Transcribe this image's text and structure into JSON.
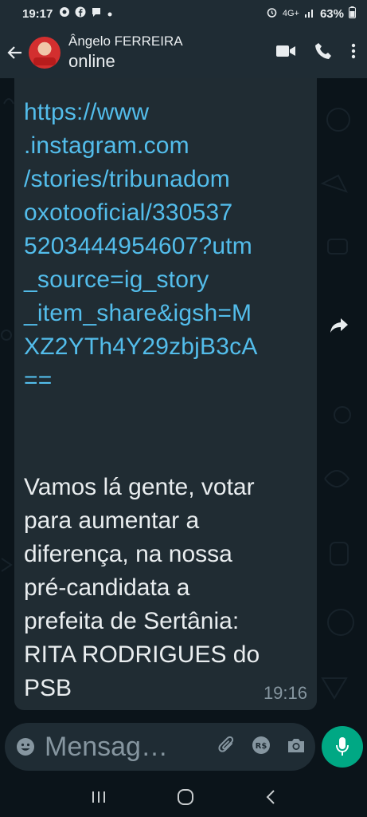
{
  "status_bar": {
    "time": "19:17",
    "network": "4G+",
    "battery": "63%"
  },
  "header": {
    "contact_name": "Ângelo FERREIRA",
    "contact_status": "online"
  },
  "message": {
    "link": "https://www.instagram.com/stories/tribunadomoxotooficial/3305375203444954607?utm_source=ig_story_item_share&igsh=MXZ2YTh4Y29zbjB3cA==",
    "link_lines": [
      "https://www",
      ".instagram.com",
      "/stories/tribunadom",
      "oxotooficial/330537",
      "5203444954607?utm",
      "_source=ig_story",
      "_item_share&igsh=M",
      "XZ2YTh4Y29zbjB3cA",
      "=="
    ],
    "body_lines": [
      "Vamos lá gente, votar",
      "para aumentar a",
      "diferença, na nossa",
      "pré-candidata a",
      "prefeita de Sertânia:",
      "RITA RODRIGUES do",
      "PSB"
    ],
    "time": "19:16"
  },
  "input": {
    "placeholder": "Mensag…"
  },
  "colors": {
    "header_bg": "#1f2c34",
    "chat_bg": "#0b141a",
    "bubble_bg": "#202c33",
    "link": "#53bdeb",
    "accent": "#00a884"
  }
}
